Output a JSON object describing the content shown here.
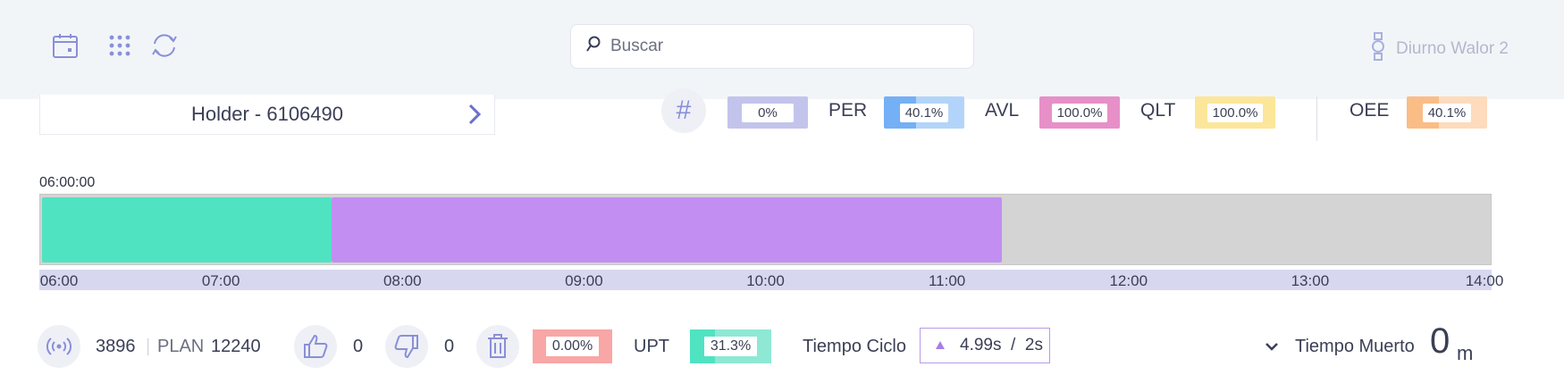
{
  "topbar": {
    "icons": [
      "calendar-icon",
      "apps-grid-icon",
      "refresh-icon"
    ],
    "search": {
      "placeholder": "Buscar",
      "value": ""
    },
    "user_label": "Diurno Walor 2",
    "user_icon": "watch-icon"
  },
  "holder": {
    "label": "Holder - 6106490"
  },
  "metrics": {
    "hash_value": "0%",
    "per": {
      "label": "PER",
      "value": "40.1%",
      "fill": 0.401,
      "color": "#74b0f5"
    },
    "avl": {
      "label": "AVL",
      "value": "100.0%",
      "fill": 1.0,
      "color": "#e790c8"
    },
    "qlt": {
      "label": "QLT",
      "value": "100.0%",
      "fill": 1.0,
      "color": "#fce69a"
    },
    "oee": {
      "label": "OEE",
      "value": "40.1%",
      "fill": 0.401,
      "color": "#fbbd86"
    },
    "hash_color": "#c3c4ec"
  },
  "timeline": {
    "start_label": "06:00:00",
    "range_hours": [
      6,
      14
    ],
    "segments": [
      {
        "start": 6.0,
        "end": 7.6,
        "color": "#4fe3c2"
      },
      {
        "start": 7.6,
        "end": 11.3,
        "color": "#c38ef2"
      }
    ],
    "ticks": [
      "06:00",
      "07:00",
      "08:00",
      "09:00",
      "10:00",
      "11:00",
      "12:00",
      "13:00",
      "14:00"
    ]
  },
  "bottom": {
    "count": "3896",
    "plan_label": "PLAN",
    "plan_value": "12240",
    "likes": "0",
    "dislikes": "0",
    "scrap_pct": "0.00%",
    "upt_label": "UPT",
    "upt_value": "31.3%",
    "upt_fill": 0.313,
    "cycle_label": "Tiempo Ciclo",
    "cycle_value": "4.99s  /  2s",
    "dead_label": "Tiempo Muerto",
    "dead_value": "0",
    "dead_unit": "m"
  }
}
